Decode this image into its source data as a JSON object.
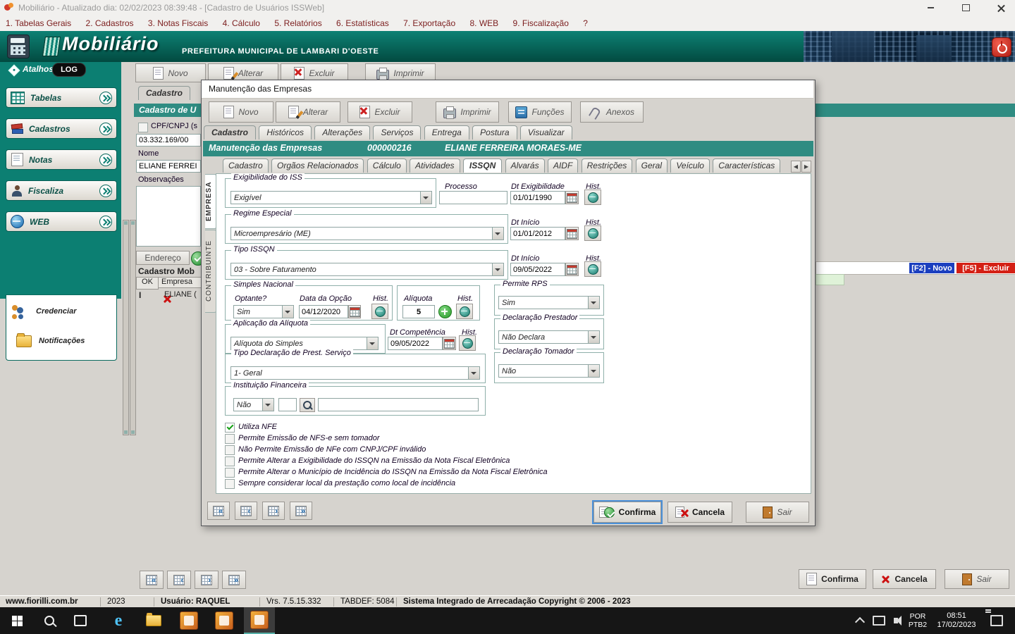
{
  "icons": {
    "nav_first": "«",
    "nav_prev": "‹",
    "nav_next": "›",
    "nav_last": "»",
    "arrow_left": "◀",
    "arrow_right": "▶",
    "edge": "e"
  },
  "titlebar": {
    "title": "Mobiliário - Atualizado dia: 02/02/2023 08:39:48 - [Cadastro de Usuários ISSWeb]"
  },
  "menubar": {
    "items": [
      "1. Tabelas Gerais",
      "2. Cadastros",
      "3. Notas Fiscais",
      "4. Cálculo",
      "5. Relatórios",
      "6. Estatísticas",
      "7. Exportação",
      "8. WEB",
      "9. Fiscalização",
      "?"
    ]
  },
  "banner": {
    "app": "Mobiliário",
    "subtitle": "PREFEITURA MUNICIPAL DE LAMBARI D'OESTE"
  },
  "sidebar": {
    "atalhos": "Atalhos",
    "log": "LOG",
    "items": [
      {
        "label": "Tabelas"
      },
      {
        "label": "Cadastros"
      },
      {
        "label": "Notas"
      },
      {
        "label": "Fiscaliza"
      },
      {
        "label": "WEB"
      }
    ],
    "web_children": [
      {
        "label": "Credenciar"
      },
      {
        "label": "Notificações"
      }
    ]
  },
  "main": {
    "toolbar": [
      "Novo",
      "Alterar",
      "Excluir",
      "Imprimir"
    ],
    "tab": "Cadastro",
    "panel_title": "Cadastro de U",
    "cpf_label": "CPF/CNPJ (s",
    "cpf_value": "03.332.169/00",
    "nome_label": "Nome",
    "nome_value": "ELIANE FERREI",
    "obs_label": "Observações",
    "endereco": "Endereço",
    "grid_title": "Cadastro Mob",
    "grid_headers": [
      "OK",
      "Empresa"
    ],
    "grid_row": {
      "indicator": "I",
      "empresa": "ELIANE ("
    },
    "hotkey_novo": "[F2] - Novo",
    "hotkey_excluir": "[F5] - Excluir",
    "confirma": "Confirma",
    "cancela": "Cancela",
    "sair": "Sair"
  },
  "dialog": {
    "title": "Manutenção das Empresas",
    "toolbar": [
      "Novo",
      "Alterar",
      "Excluir",
      "Imprimir",
      "Funções",
      "Anexos"
    ],
    "tabs_top": [
      "Cadastro",
      "Históricos",
      "Alterações",
      "Serviços",
      "Entrega",
      "Postura",
      "Visualizar"
    ],
    "header": {
      "title": "Manutenção das Empresas",
      "code": "000000216",
      "name": "ELIANE FERREIRA MORAES-ME"
    },
    "tabs_inner": [
      "Cadastro",
      "Orgãos Relacionados",
      "Cálculo",
      "Atividades",
      "ISSQN",
      "Alvarás",
      "AIDF",
      "Restrições",
      "Geral",
      "Veículo",
      "Características"
    ],
    "side_tabs": [
      "EMPRESA",
      "CONTRIBUINTE"
    ],
    "form": {
      "exigibilidade": {
        "legend": "Exigibilidade do ISS",
        "value": "Exigível"
      },
      "processo_label": "Processo",
      "processo_value": "",
      "dt_exigibilidade_label": "Dt Exigibilidade",
      "dt_exigibilidade": "01/01/1990",
      "hist_label": "Hist.",
      "regime": {
        "legend": "Regime Especial",
        "value": "Microempresário (ME)",
        "dt_label": "Dt Início",
        "dt": "01/01/2012"
      },
      "tipo_issqn": {
        "legend": "Tipo ISSQN",
        "value": "03 - Sobre Faturamento",
        "dt_label": "Dt Início",
        "dt": "09/05/2022"
      },
      "simples": {
        "legend": "Simples Nacional",
        "optante_label": "Optante?",
        "optante": "Sim",
        "data_label": "Data da Opção",
        "data": "04/12/2020"
      },
      "aliquota": {
        "legend": "Alíquota",
        "value": "5"
      },
      "permite_rps": {
        "legend": "Permite RPS",
        "value": "Sim"
      },
      "aplicacao": {
        "legend": "Aplicação da Alíquota",
        "value": "Alíquota do Simples",
        "dt_label": "Dt Competência",
        "dt": "09/05/2022"
      },
      "decl_prestador": {
        "legend": "Declaração Prestador",
        "value": "Não Declara"
      },
      "tipo_decl": {
        "legend": "Tipo Declaração de Prest. Serviço",
        "value": "1- Geral"
      },
      "decl_tomador": {
        "legend": "Declaração Tomador",
        "value": "Não"
      },
      "inst_financeira": {
        "legend": "Instituição Financeira",
        "value": "Não",
        "field1": "",
        "field2": ""
      },
      "checkboxes": [
        {
          "label": "Utiliza NFE",
          "checked": true
        },
        {
          "label": "Permite Emissão de NFS-e sem tomador",
          "checked": false
        },
        {
          "label": "Não Permite Emissão de NFe com CNPJ/CPF inválido",
          "checked": false
        },
        {
          "label": "Permite Alterar a Exigibilidade do ISSQN na Emissão da Nota Fiscal Eletrônica",
          "checked": false
        },
        {
          "label": "Permite Alterar o Município de Incidência do ISSQN na Emissão da Nota Fiscal Eletrônica",
          "checked": false
        },
        {
          "label": "Sempre considerar local da prestação como local de incidência",
          "checked": false
        }
      ]
    },
    "buttons": {
      "confirma": "Confirma",
      "cancela": "Cancela",
      "sair": "Sair"
    }
  },
  "statusbar": {
    "site": "www.fiorilli.com.br",
    "year": "2023",
    "user": "Usuário: RAQUEL",
    "version": "Vrs. 7.5.15.332",
    "tabdef": "TABDEF: 5084",
    "copyright": "Sistema Integrado de Arrecadação Copyright © 2006 - 2023"
  },
  "taskbar": {
    "lang_top": "POR",
    "lang_bottom": "PTB2",
    "time": "08:51",
    "date": "17/02/2023"
  }
}
